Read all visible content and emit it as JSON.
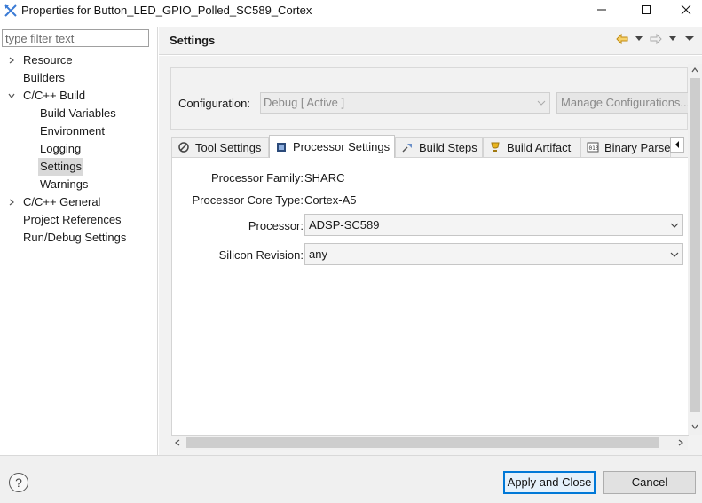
{
  "window": {
    "title": "Properties for Button_LED_GPIO_Polled_SC589_Cortex"
  },
  "filter": {
    "placeholder": "type filter text"
  },
  "tree": {
    "items": [
      {
        "label": "Resource",
        "chevron": "right"
      },
      {
        "label": "Builders",
        "chevron": ""
      },
      {
        "label": "C/C++ Build",
        "chevron": "down"
      },
      {
        "label": "Build Variables",
        "chevron": ""
      },
      {
        "label": "Environment",
        "chevron": ""
      },
      {
        "label": "Logging",
        "chevron": ""
      },
      {
        "label": "Settings",
        "chevron": "",
        "selected": true
      },
      {
        "label": "Warnings",
        "chevron": ""
      },
      {
        "label": "C/C++ General",
        "chevron": "right"
      },
      {
        "label": "Project References",
        "chevron": ""
      },
      {
        "label": "Run/Debug Settings",
        "chevron": ""
      }
    ]
  },
  "header": {
    "title": "Settings"
  },
  "configuration": {
    "label": "Configuration:",
    "value": "Debug  [ Active ]",
    "manage_label": "Manage Configurations..."
  },
  "tabs": [
    {
      "label": "Tool Settings",
      "icon": "wrench-gear-icon"
    },
    {
      "label": "Processor Settings",
      "icon": "chip-icon",
      "active": true
    },
    {
      "label": "Build Steps",
      "icon": "build-steps-icon"
    },
    {
      "label": "Build Artifact",
      "icon": "trophy-icon"
    },
    {
      "label": "Binary Parsers",
      "icon": "binary-icon"
    }
  ],
  "processor": {
    "family_label": "Processor Family:",
    "family_value": "SHARC",
    "core_label": "Processor Core Type:",
    "core_value": "Cortex-A5",
    "processor_label": "Processor:",
    "processor_value": "ADSP-SC589",
    "silicon_label": "Silicon Revision:",
    "silicon_value": "any"
  },
  "footer": {
    "apply_label": "Apply and Close",
    "cancel_label": "Cancel"
  },
  "colors": {
    "accent": "#0078d7",
    "selection": "#d9d9d9",
    "panel_bg": "#f2f2f2",
    "nav_arrow": "#e0a020"
  }
}
